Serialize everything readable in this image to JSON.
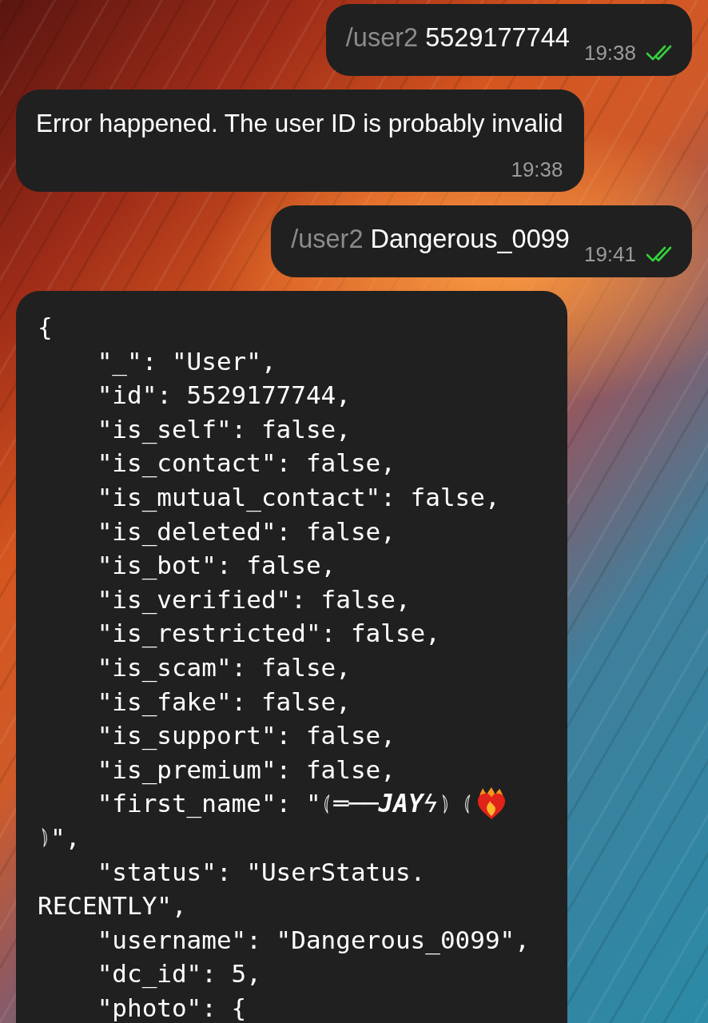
{
  "messages": [
    {
      "kind": "outgoing",
      "command": "/user2",
      "text": "5529177744",
      "time": "19:38",
      "read": true
    },
    {
      "kind": "incoming",
      "text": "Error happened. The user ID is probably invalid",
      "time": "19:38"
    },
    {
      "kind": "outgoing",
      "command": "/user2",
      "text": "Dangerous_0099",
      "time": "19:41",
      "read": true
    },
    {
      "kind": "code",
      "opening": "{",
      "entries": [
        {
          "kind": "text",
          "text": "\"_\": \"User\","
        },
        {
          "kind": "text",
          "text": "\"id\": 5529177744,"
        },
        {
          "kind": "text",
          "text": "\"is_self\": false,"
        },
        {
          "kind": "text",
          "text": "\"is_contact\": false,"
        },
        {
          "kind": "text",
          "text": "\"is_mutual_contact\": false,"
        },
        {
          "kind": "text",
          "text": "\"is_deleted\": false,"
        },
        {
          "kind": "text",
          "text": "\"is_bot\": false,"
        },
        {
          "kind": "text",
          "text": "\"is_verified\": false,"
        },
        {
          "kind": "text",
          "text": "\"is_restricted\": false,"
        },
        {
          "kind": "text",
          "text": "\"is_scam\": false,"
        },
        {
          "kind": "text",
          "text": "\"is_fake\": false,"
        },
        {
          "kind": "text",
          "text": "\"is_support\": false,"
        },
        {
          "kind": "text",
          "text": "\"is_premium\": false,"
        },
        {
          "kind": "fancy",
          "text": "\"first_name\": \"",
          "name": "═──**JAY**ϟ",
          "wrap": "\","
        },
        {
          "kind": "text",
          "text": "\"status\": \"UserStatus.",
          "wrap": "RECENTLY\","
        },
        {
          "kind": "text",
          "text": "\"username\": \"Dangerous_0099\","
        },
        {
          "kind": "text",
          "text": "\"dc_id\": 5,"
        },
        {
          "kind": "text",
          "text": "\"photo\": {"
        }
      ]
    }
  ]
}
